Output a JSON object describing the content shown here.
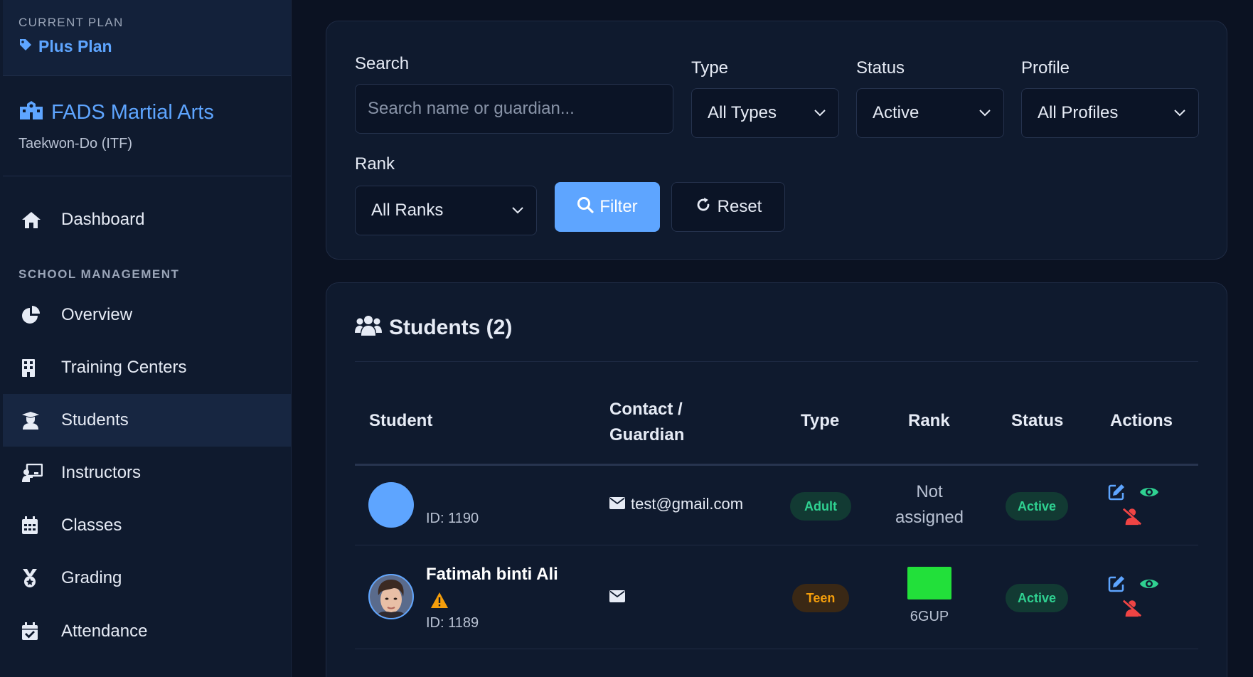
{
  "sidebar": {
    "plan_label": "CURRENT PLAN",
    "plan_name": "Plus Plan",
    "school_name": "FADS Martial Arts",
    "school_sub": "Taekwon-Do (ITF)",
    "dashboard": "Dashboard",
    "section_label": "SCHOOL MANAGEMENT",
    "items": [
      "Overview",
      "Training Centers",
      "Students",
      "Instructors",
      "Classes",
      "Grading",
      "Attendance"
    ],
    "active_item": "Students"
  },
  "filters": {
    "search_label": "Search",
    "search_placeholder": "Search name or guardian...",
    "type_label": "Type",
    "type_value": "All Types",
    "status_label": "Status",
    "status_value": "Active",
    "profile_label": "Profile",
    "profile_value": "All Profiles",
    "rank_label": "Rank",
    "rank_value": "All Ranks",
    "filter_button": "Filter",
    "reset_button": "Reset"
  },
  "students": {
    "title": "Students (2)",
    "columns": {
      "student": "Student",
      "contact_line1": "Contact /",
      "contact_line2": "Guardian",
      "type": "Type",
      "rank": "Rank",
      "status": "Status",
      "actions": "Actions"
    },
    "rows": [
      {
        "name": "",
        "id": "ID: 1190",
        "email": "test@gmail.com",
        "type": "Adult",
        "rank_line1": "Not",
        "rank_line2": "assigned",
        "status": "Active"
      },
      {
        "name": "Fatimah binti Ali",
        "id": "ID: 1189",
        "email": "",
        "type": "Teen",
        "rank_code": "6GUP",
        "rank_color": "#22e03a",
        "status": "Active"
      }
    ]
  },
  "colors": {
    "accent": "#5ea5ff",
    "success": "#2fd191",
    "warning": "#f59e0b",
    "danger": "#ef4444"
  }
}
